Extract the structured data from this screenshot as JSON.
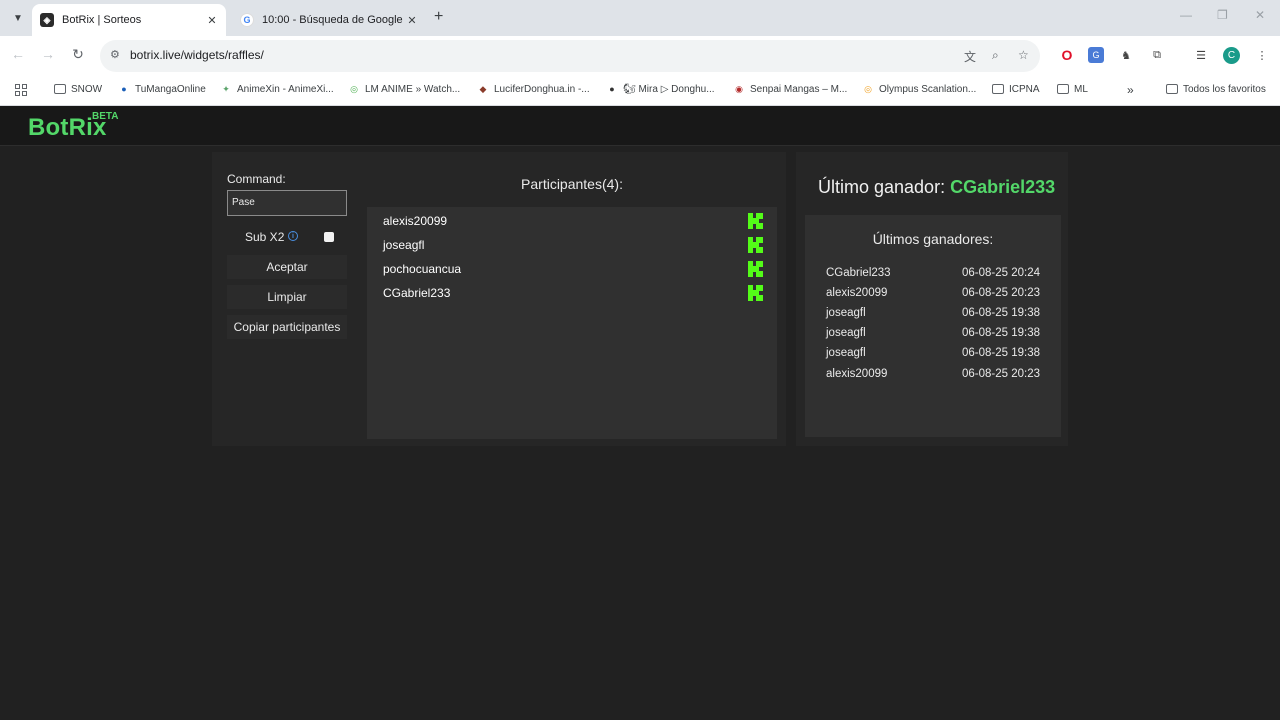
{
  "browser": {
    "tabs": [
      {
        "title": "BotRix | Sorteos",
        "close": "✕"
      },
      {
        "title": "10:00 - Búsqueda de Google",
        "close": "✕"
      }
    ],
    "new_tab": "+",
    "url": "botrix.live/widgets/raffles/",
    "bookmarks": [
      "SNOW",
      "TuMangaOnline",
      "AnimeXin - AnimeXi...",
      "LM ANIME » Watch...",
      "LuciferDonghua.in -...",
      "🐿 Mira ▷ Donghu...",
      "Senpai Mangas – M...",
      "Olympus Scanlation...",
      "ICPNA",
      "ML"
    ],
    "more_bookmarks": "»",
    "all_favorites": "Todos los favoritos",
    "avatar_letter": "C"
  },
  "app": {
    "logo": "BotRix",
    "beta": "BETA",
    "command_label": "Command:",
    "command_value": "Pase",
    "sub_label": "Sub X2",
    "sub_checked": false,
    "buttons": {
      "accept": "Aceptar",
      "clear": "Limpiar",
      "copy": "Copiar participantes"
    },
    "participants_title": "Participantes(4):",
    "participants": [
      "alexis20099",
      "joseagfl",
      "pochocuancua",
      "CGabriel233"
    ],
    "last_winner_label": "Último ganador:",
    "last_winner_name": "CGabriel233",
    "recent_winners_title": "Últimos ganadores:",
    "recent_winners": [
      {
        "name": "CGabriel233",
        "date": "06-08-25 20:24"
      },
      {
        "name": "alexis20099",
        "date": "06-08-25 20:23"
      },
      {
        "name": "joseagfl",
        "date": "06-08-25 19:38"
      },
      {
        "name": "joseagfl",
        "date": "06-08-25 19:38"
      },
      {
        "name": "joseagfl",
        "date": "06-08-25 19:38"
      },
      {
        "name": "alexis20099",
        "date": "06-08-25 20:23"
      }
    ]
  },
  "colors": {
    "accent_green": "#53d769",
    "kick_green": "#53fc18",
    "background": "#212121"
  }
}
